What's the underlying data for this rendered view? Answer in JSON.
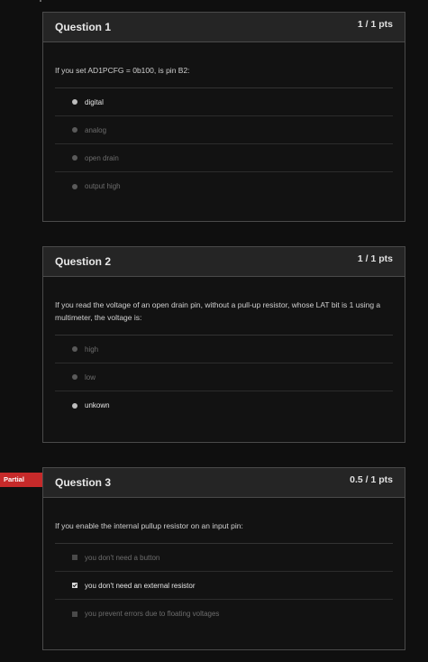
{
  "questions": [
    {
      "title": "Question 1",
      "points": "1 / 1 pts",
      "prompt": "If you set AD1PCFG = 0b100, is pin B2:",
      "answers": [
        "digital",
        "analog",
        "open drain",
        "output high"
      ]
    },
    {
      "title": "Question 2",
      "points": "1 / 1 pts",
      "prompt": "If you read the voltage of an open drain pin, without a pull-up resistor, whose LAT bit is 1 using a multimeter, the voltage is:",
      "answers": [
        "high",
        "low",
        "unkown"
      ]
    },
    {
      "title": "Question 3",
      "points": "0.5 / 1 pts",
      "badge": "Partial",
      "prompt": "If you enable the internal pullup resistor on an input pin:",
      "answers": [
        "you don't need a button",
        "you don't need an external resistor",
        "you prevent errors due to floating voltages"
      ]
    }
  ],
  "selections": {
    "q1": "digital",
    "q2": "unkown",
    "q3": "you don't need an external resistor"
  },
  "colors": {
    "background": "#0f0f0f",
    "header": "#252525",
    "border": "#4a4a4a",
    "partial_badge": "#c62a2a"
  },
  "icons": {
    "radio": "radio-dot-icon",
    "checkbox": "checkbox-icon",
    "check": "checkmark-icon"
  }
}
